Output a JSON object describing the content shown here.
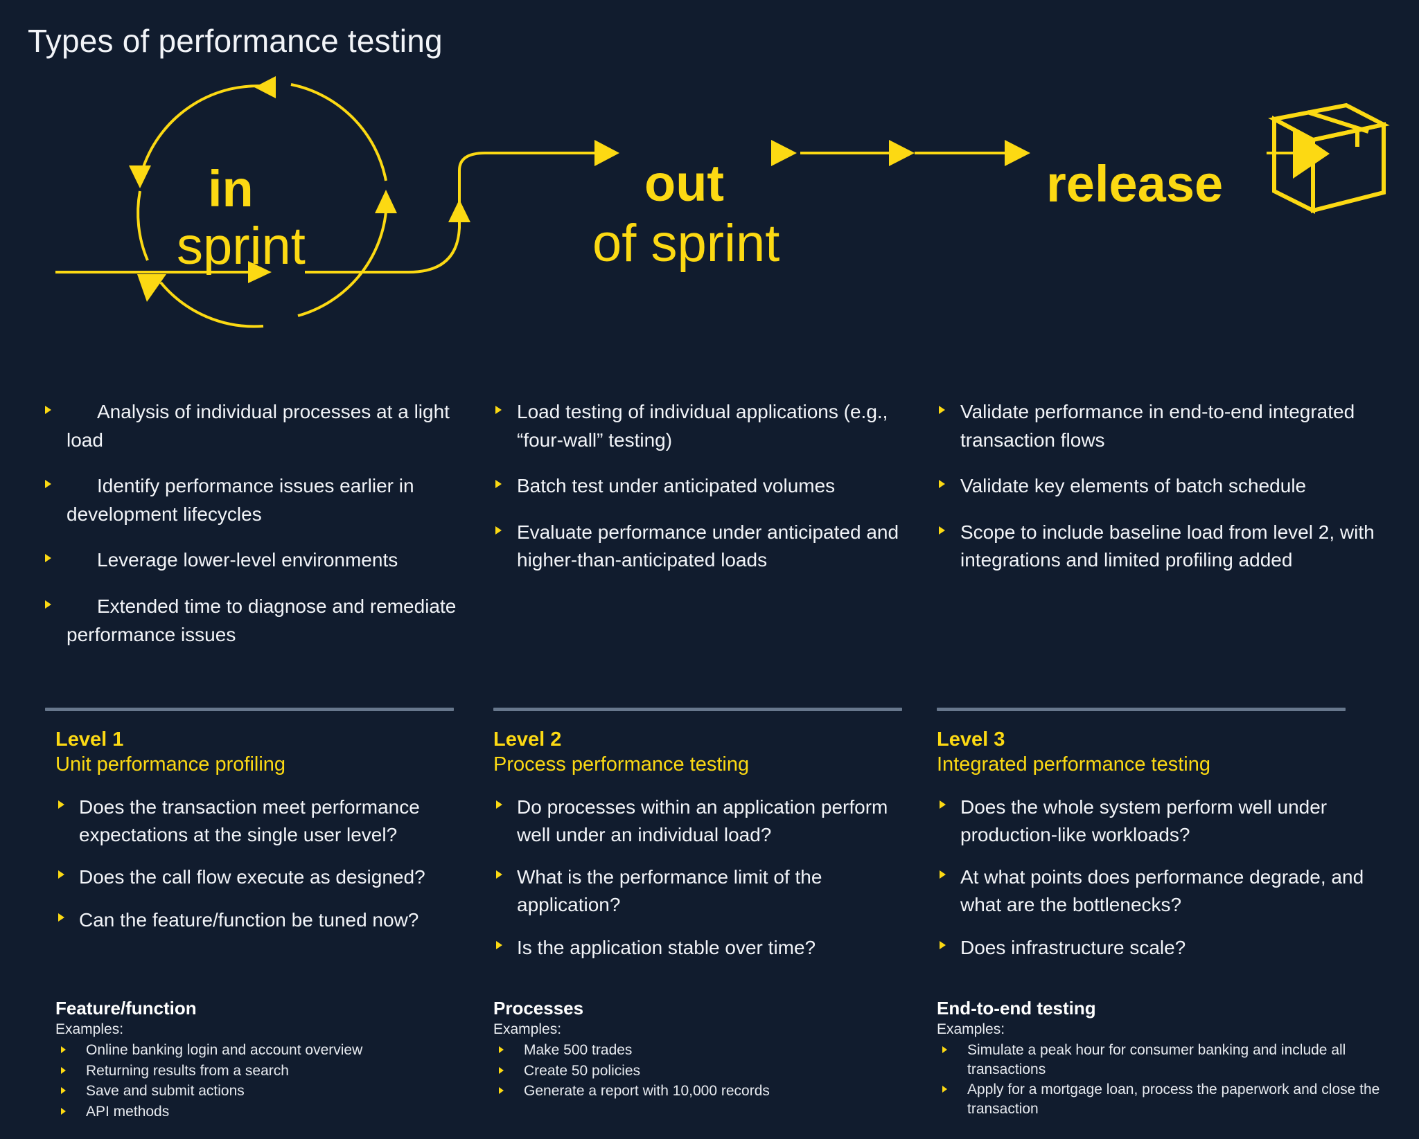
{
  "page": {
    "title": "Types of performance testing",
    "background_color": "#111c2e",
    "accent_color": "#FCD913",
    "text_color": "#f2f4f8",
    "divider_color": "#67778c"
  },
  "diagram": {
    "stage_in": {
      "bold": "in",
      "light": "sprint"
    },
    "stage_out": {
      "bold": "out",
      "light": "of sprint"
    },
    "stage_release": {
      "bold": "release"
    },
    "release_icon": "package-box-icon"
  },
  "columns": [
    {
      "bullets": [
        "Analysis of individual processes at a light load",
        "Identify performance issues earlier in development lifecycles",
        "Leverage lower-level environments",
        "Extended time to diagnose and remediate performance issues"
      ]
    },
    {
      "bullets": [
        "Load testing of individual applications (e.g., “four-wall” testing)",
        "Batch test under anticipated volumes",
        "Evaluate performance under anticipated and higher-than-anticipated loads"
      ]
    },
    {
      "bullets": [
        "Validate performance in end-to-end integrated transaction flows",
        "Validate key elements of batch schedule",
        "Scope to include baseline load from level 2, with integrations and limited profiling added"
      ]
    }
  ],
  "levels": [
    {
      "title": "Level 1",
      "subtitle": "Unit performance profiling",
      "questions": [
        "Does the transaction meet performance expectations at the single user level?",
        "Does the call flow execute as designed?",
        "Can the feature/function be tuned now?"
      ],
      "examples_heading": "Feature/function",
      "examples_label": "Examples:",
      "examples": [
        "Online banking login and account overview",
        "Returning results from a search",
        "Save and submit actions",
        "API methods"
      ]
    },
    {
      "title": "Level 2",
      "subtitle": "Process performance testing",
      "questions": [
        "Do processes within an application perform well under an individual load?",
        "What is the performance limit of the application?",
        "Is the application stable over time?"
      ],
      "examples_heading": "Processes",
      "examples_label": "Examples:",
      "examples": [
        "Make 500 trades",
        "Create 50 policies",
        "Generate a report with 10,000 records"
      ]
    },
    {
      "title": "Level 3",
      "subtitle": "Integrated performance testing",
      "questions": [
        "Does the whole system perform well under production-like workloads?",
        "At what points does performance degrade, and what are the bottlenecks?",
        "Does infrastructure scale?"
      ],
      "examples_heading": "End-to-end testing",
      "examples_label": "Examples:",
      "examples": [
        "Simulate a peak hour for consumer banking and include all transactions",
        "Apply for a mortgage loan, process the paperwork and close the transaction"
      ]
    }
  ]
}
